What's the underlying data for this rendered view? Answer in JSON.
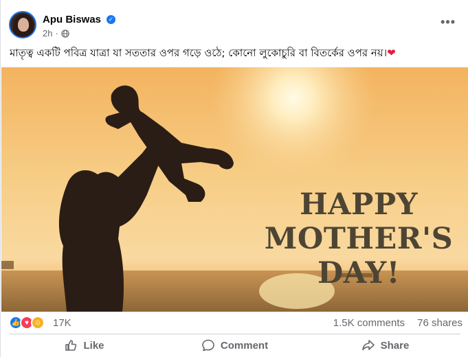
{
  "post": {
    "author": "Apu Biswas",
    "time": "2h",
    "verified_icon": "verified-badge-icon",
    "visibility_icon": "globe-icon",
    "more_label": "•••",
    "caption": "মাতৃত্ব একটি পবিত্র যাত্রা যা সততার ওপর গড়ে ওঠে; কোনো লুকোচুরি বা বিতর্কের ওপর নয়।",
    "caption_emoji": "❤"
  },
  "image": {
    "lines": [
      "HAPPY",
      "MOTHER'S",
      "DAY!"
    ],
    "text_color": "#4d4534"
  },
  "stats": {
    "reactions": [
      "like",
      "love",
      "care"
    ],
    "reaction_count": "17K",
    "comments": "1.5K comments",
    "shares": "76 shares"
  },
  "actions": {
    "like": "Like",
    "comment": "Comment",
    "share": "Share"
  },
  "colors": {
    "brand_blue": "#1877f2",
    "love_red": "#f33e58",
    "care_yellow": "#f7b125",
    "muted_text": "#65676b"
  }
}
